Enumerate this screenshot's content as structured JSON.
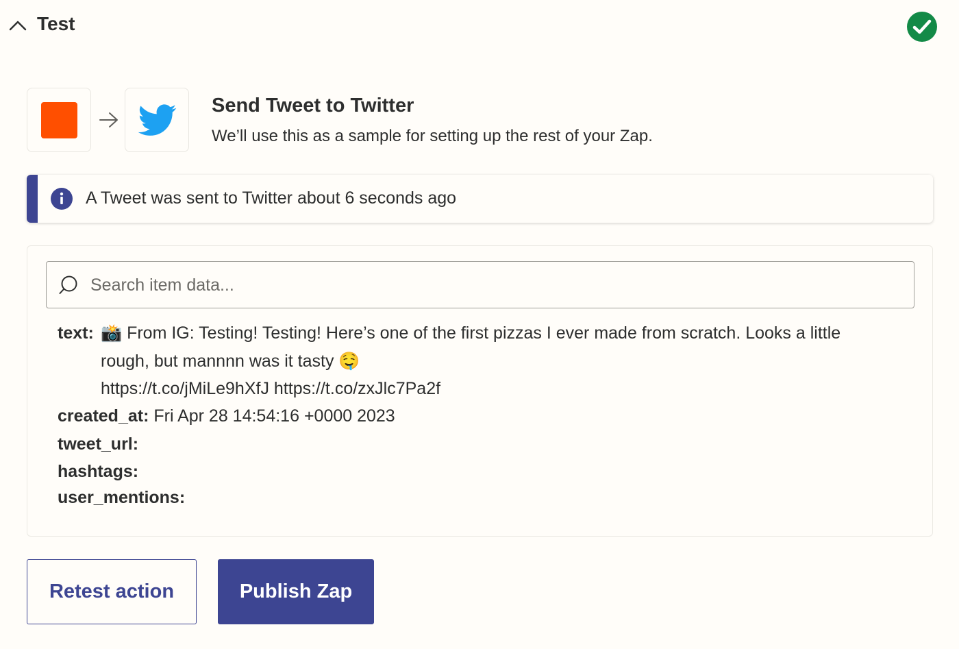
{
  "header": {
    "title": "Test",
    "status_icon": "check-circle-icon",
    "status_color": "#138a47"
  },
  "step": {
    "trigger_icon": "orange-square-icon",
    "trigger_color": "#ff4f00",
    "action_icon": "twitter-bird-icon",
    "action_color": "#1da1f2",
    "title": "Send Tweet to Twitter",
    "subtitle": "We’ll use this as a sample for setting up the rest of your Zap."
  },
  "alert": {
    "icon": "info-icon",
    "text": "A Tweet was sent to Twitter about 6 seconds ago",
    "accent_color": "#3d4592"
  },
  "search": {
    "placeholder": "Search item data...",
    "value": ""
  },
  "fields": {
    "text_key": "text:",
    "text_line1": "📸 From IG: Testing! Testing! Here’s one of the first pizzas I ever made from scratch. Looks a little",
    "text_line2": "rough, but mannnn was it tasty 🤤",
    "text_line3": "https://t.co/jMiLe9hXfJ https://t.co/zxJlc7Pa2f",
    "created_at_key": "created_at:",
    "created_at_value": "Fri Apr 28 14:54:16 +0000 2023",
    "tweet_url_key": "tweet_url:",
    "hashtags_key": "hashtags:",
    "user_mentions_key": "user_mentions:"
  },
  "actions": {
    "retest_label": "Retest action",
    "publish_label": "Publish Zap",
    "primary_color": "#3d4592"
  }
}
